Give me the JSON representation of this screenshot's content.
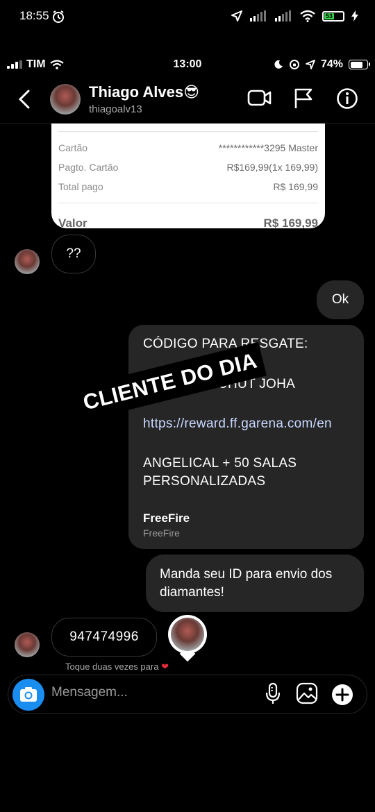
{
  "android_status": {
    "time": "18:55",
    "battery": "53"
  },
  "ios_status": {
    "carrier": "TIM",
    "time": "13:00",
    "battery": "74%"
  },
  "header": {
    "name": "Thiago Alves😎",
    "username": "thiagoalv13"
  },
  "receipt": {
    "rows": [
      {
        "label": "Cartão",
        "value": "************3295 Master"
      },
      {
        "label": "Pagto. Cartão",
        "value": "R$169,99(1x 169,99)"
      },
      {
        "label": "Total pago",
        "value": "R$ 169,99"
      }
    ],
    "total_label": "Valor",
    "total_value": "R$ 169,99"
  },
  "messages": {
    "question": "??",
    "ok": "Ok",
    "code_card": {
      "line1": "CÓDIGO PARA RESGATE:",
      "line2": "UHUT JOHA",
      "link": "https://reward.ff.garena.com/en",
      "line4": "ANGELICAL + 50 SALAS",
      "line5": "PERSONALIZADAS",
      "title": "FreeFire",
      "subtitle": "FreeFire"
    },
    "manda": "Manda seu ID para envio dos diamantes!",
    "id": "947474996",
    "hint": "Toque duas vezes para"
  },
  "sticker": {
    "text": "CLIENTE DO DIA"
  },
  "composer": {
    "placeholder": "Mensagem..."
  },
  "colors": {
    "accent": "#1a8df0",
    "bubble_out": "#262626",
    "heart": "#e52d3a"
  },
  "icons": [
    "alarm-icon",
    "location-icon",
    "signal-icon",
    "wifi-icon",
    "battery-icon",
    "back-icon",
    "video-icon",
    "flag-icon",
    "info-icon",
    "camera-icon",
    "mic-icon",
    "gallery-icon",
    "plus-icon",
    "heart-icon"
  ]
}
